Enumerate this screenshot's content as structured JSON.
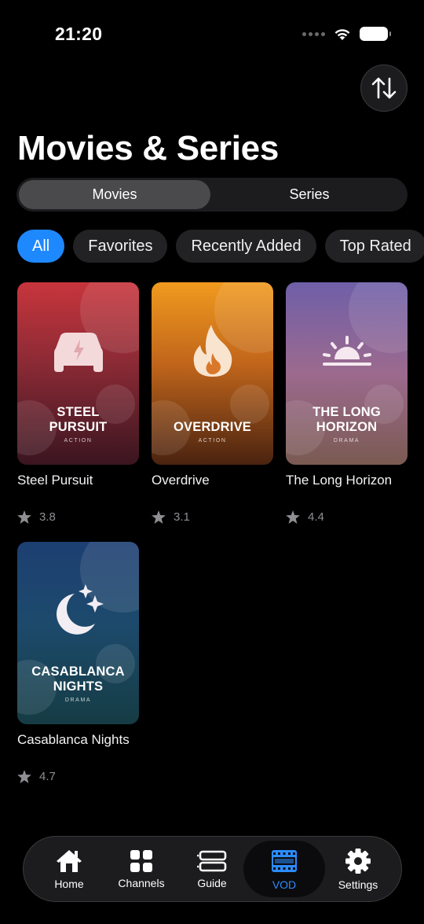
{
  "status_bar": {
    "time": "21:20"
  },
  "header": {
    "title": "Movies & Series",
    "sort_icon": "sort-arrows-icon"
  },
  "segmented": {
    "movies": "Movies",
    "series": "Series",
    "selected": "Movies"
  },
  "filters": [
    "All",
    "Favorites",
    "Recently Added",
    "Top Rated"
  ],
  "filter_selected": "All",
  "movies": [
    {
      "title": "Steel Pursuit",
      "poster_line1": "STEEL",
      "poster_line2": "PURSUIT",
      "genre": "ACTION",
      "rating": "3.8",
      "icon": "car-icon",
      "color": "#c8353c"
    },
    {
      "title": "Overdrive",
      "poster_line1": "",
      "poster_line2": "OVERDRIVE",
      "genre": "ACTION",
      "rating": "3.1",
      "icon": "flame-icon",
      "color": "#f19a1e"
    },
    {
      "title": "The Long Horizon",
      "poster_line1": "THE LONG",
      "poster_line2": "HORIZON",
      "genre": "DRAMA",
      "rating": "4.4",
      "icon": "sunrise-icon",
      "color": "#6f5fa8"
    },
    {
      "title": "Casablanca Nights",
      "poster_line1": "CASABLANCA",
      "poster_line2": "NIGHTS",
      "genre": "DRAMA",
      "rating": "4.7",
      "icon": "moon-stars-icon",
      "color": "#1d3f72"
    }
  ],
  "tab_bar": {
    "items": [
      {
        "label": "Home",
        "icon": "house-icon"
      },
      {
        "label": "Channels",
        "icon": "grid-icon"
      },
      {
        "label": "Guide",
        "icon": "guide-icon"
      },
      {
        "label": "VOD",
        "icon": "film-icon"
      },
      {
        "label": "Settings",
        "icon": "gear-icon"
      }
    ],
    "selected": "VOD",
    "accent": "#2b8cff"
  }
}
